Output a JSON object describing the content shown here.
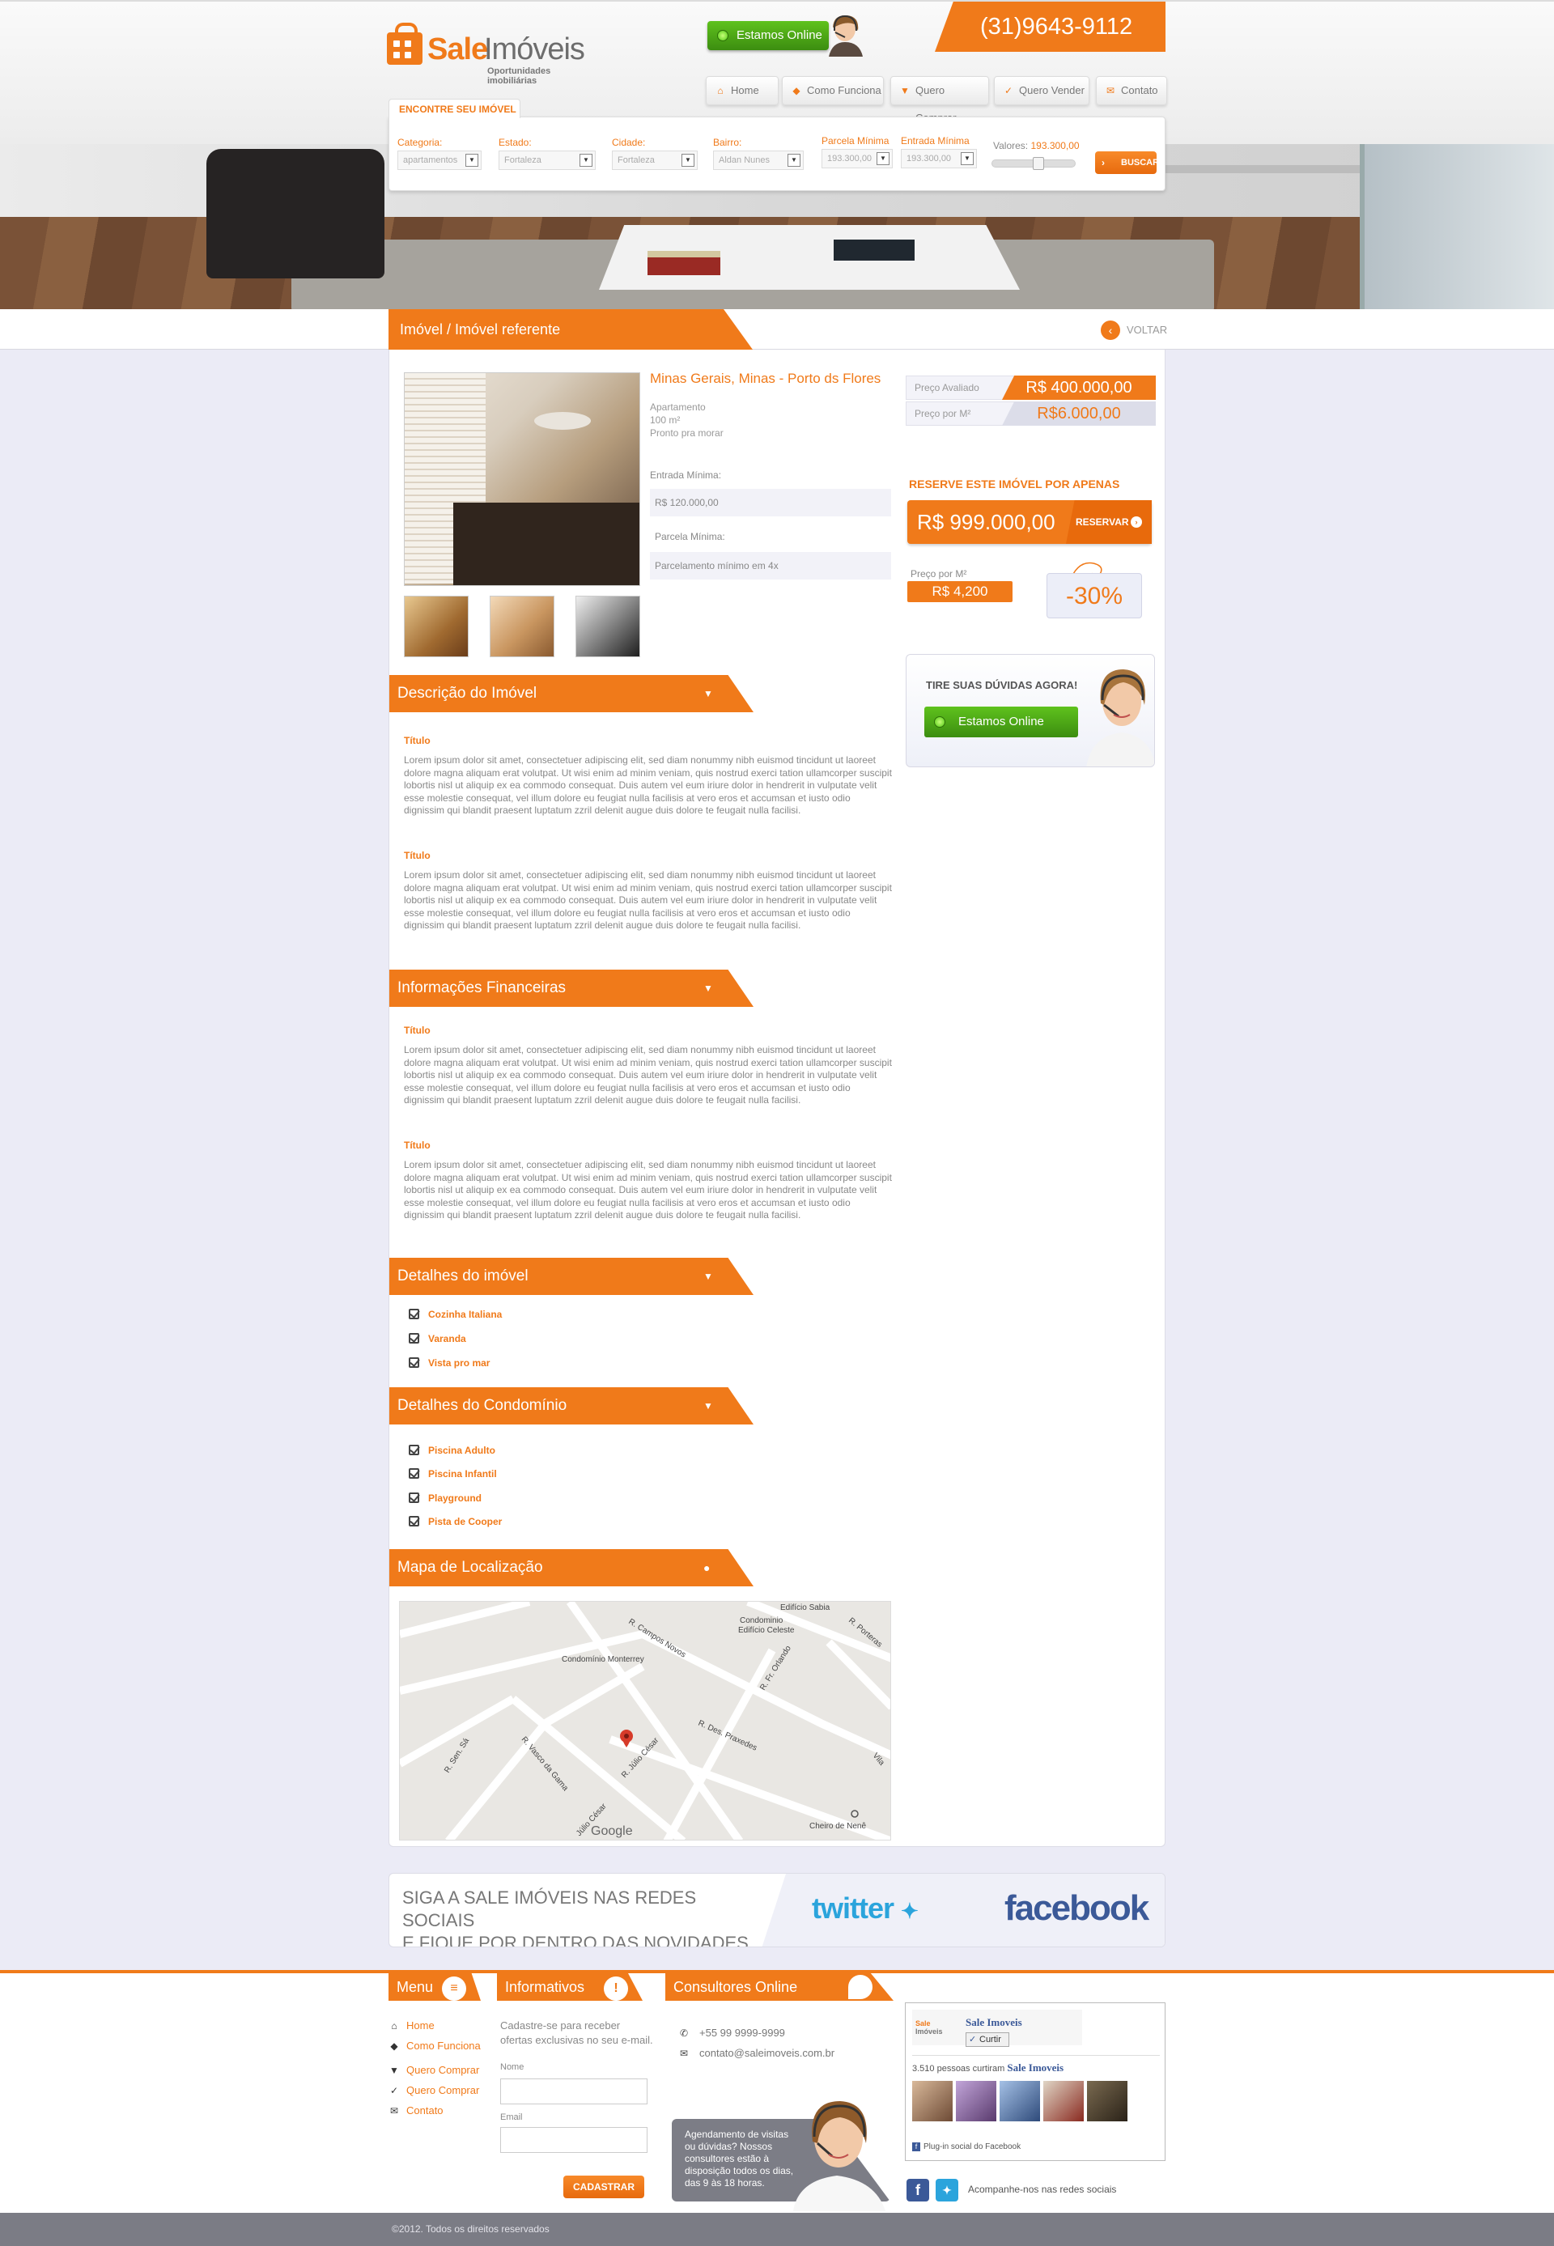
{
  "header": {
    "logo_word1": "Sale",
    "logo_word2": "Imóveis",
    "logo_sub": "Oportunidades imobiliárias",
    "online_label": "Estamos Online",
    "phone": "(31)9643-9112",
    "nav": [
      {
        "label": "Home",
        "icon": "home-icon"
      },
      {
        "label": "Como Funciona",
        "icon": "tag-icon"
      },
      {
        "label": "Quero Comprar",
        "icon": "cart-icon"
      },
      {
        "label": "Quero Vender",
        "icon": "thumbs-up-icon"
      },
      {
        "label": "Contato",
        "icon": "mail-icon"
      }
    ]
  },
  "search": {
    "tab": "ENCONTRE SEU IMÓVEL",
    "fields": [
      {
        "label": "Categoria:",
        "value": "apartamentos"
      },
      {
        "label": "Estado:",
        "value": "Fortaleza"
      },
      {
        "label": "Cidade:",
        "value": "Fortaleza"
      },
      {
        "label": "Bairro:",
        "value": "Aldan Nunes"
      },
      {
        "label": "Parcela Mínima",
        "value": "193.300,00"
      },
      {
        "label": "Entrada Mínima",
        "value": "193.300,00"
      }
    ],
    "valores_label": "Valores:",
    "valores_value": "193.300,00",
    "button": "BUSCAR"
  },
  "breadcrumb": {
    "text": "Imóvel / Imóvel referente",
    "back": "VOLTAR"
  },
  "property": {
    "location": "Minas Gerais, Minas  - Porto ds Flores",
    "specs": [
      "Apartamento",
      "100 m²",
      "Pronto pra morar"
    ],
    "entrada_label": "Entrada Mínima:",
    "entrada_value": "R$ 120.000,00",
    "parcela_label": "Parcela Mínima:",
    "parcela_value": "Parcelamento mínimo em 4x"
  },
  "pricing": {
    "avaliado_label": "Preço Avaliado",
    "avaliado_value": "R$ 400.000,00",
    "m2_label": "Preço por M²",
    "m2_value": "R$6.000,00",
    "reserve_title": "RESERVE ESTE IMÓVEL POR APENAS",
    "reserve_amount": "R$ 999.000,00",
    "reserve_button": "RESERVAR",
    "promo_m2_label": "Preço por M²",
    "promo_m2_value": "R$ 4,200",
    "discount": "-30%"
  },
  "help": {
    "title": "TIRE SUAS DÚVIDAS AGORA!",
    "button": "Estamos Online"
  },
  "sections": {
    "descricao": "Descrição do Imóvel",
    "financeiras": "Informações Financeiras",
    "detalhes_imovel": "Detalhes do imóvel",
    "detalhes_condominio": "Detalhes do Condomínio",
    "mapa": "Mapa de Localização"
  },
  "content": {
    "subtitle": "Título",
    "lorem": "Lorem ipsum dolor sit amet, consectetuer adipiscing elit, sed diam nonummy nibh euismod tincidunt ut laoreet dolore magna aliquam erat volutpat. Ut wisi enim ad minim veniam, quis nostrud exerci tation ullamcorper suscipit lobortis nisl ut aliquip ex ea commodo consequat. Duis autem vel eum iriure dolor in hendrerit in vulputate velit esse molestie consequat, vel illum dolore eu feugiat nulla facilisis at vero eros et accumsan et iusto odio dignissim qui blandit praesent luptatum zzril delenit augue duis dolore te feugait nulla facilisi."
  },
  "detalhes_imovel": [
    "Cozinha Italiana",
    "Varanda",
    "Vista pro mar"
  ],
  "detalhes_condominio": [
    "Piscina Adulto",
    "Piscina Infantil",
    "Playground",
    "Pista de Cooper"
  ],
  "map": {
    "labels": [
      "Edifício Sabia",
      "Condominio",
      "Edifício Celeste",
      "R. Campos Novos",
      "R. Porteras",
      "Condomínio Monterrey",
      "R. Fr. Orlando",
      "R. Des. Praxedes",
      "R. Sen. Sá",
      "R. Vasco da Gama",
      "R. Júlio César",
      "Júlio César",
      "Vila",
      "Cheiro de Nenê",
      "Google"
    ]
  },
  "social": {
    "line1": "SIGA A SALE IMÓVEIS NAS REDES SOCIAIS",
    "line2": "E FIQUE POR DENTRO DAS NOVIDADES.",
    "twitter": "twitter",
    "facebook": "facebook"
  },
  "footer": {
    "menu_title": "Menu",
    "menu": [
      {
        "label": "Home",
        "icon": "home-icon"
      },
      {
        "label": "Como Funciona",
        "icon": "tag-icon"
      },
      {
        "label": "Quero Comprar",
        "icon": "cart-icon"
      },
      {
        "label": "Quero Comprar",
        "icon": "thumbs-up-icon"
      },
      {
        "label": "Contato",
        "icon": "mail-icon"
      }
    ],
    "info_title": "Informativos",
    "info_text": "Cadastre-se para receber ofertas exclusivas no seu e-mail.",
    "nome_label": "Nome",
    "email_label": "Email",
    "cadastrar": "CADASTRAR",
    "consult_title": "Consultores Online",
    "phone": "+55  99 9999-9999",
    "email": "contato@saleimoveis.com.br",
    "agenda": "Agendamento de visitas ou dúvidas? Nossos consultores estão à disposição todos os dias, das 9 às 18 horas.",
    "fb_name": "Sale Imoveis",
    "fb_like": "Curtir",
    "fb_count": "3.510 pessoas curtiram",
    "fb_plugin": "Plug-in social do Facebook",
    "follow": "Acompanhe-nos nas redes sociais",
    "copyright": "©2012. Todos os direitos reservados"
  },
  "colors": {
    "accent": "#f07a1a",
    "green": "#4aa517",
    "bg": "#ebebf6"
  }
}
